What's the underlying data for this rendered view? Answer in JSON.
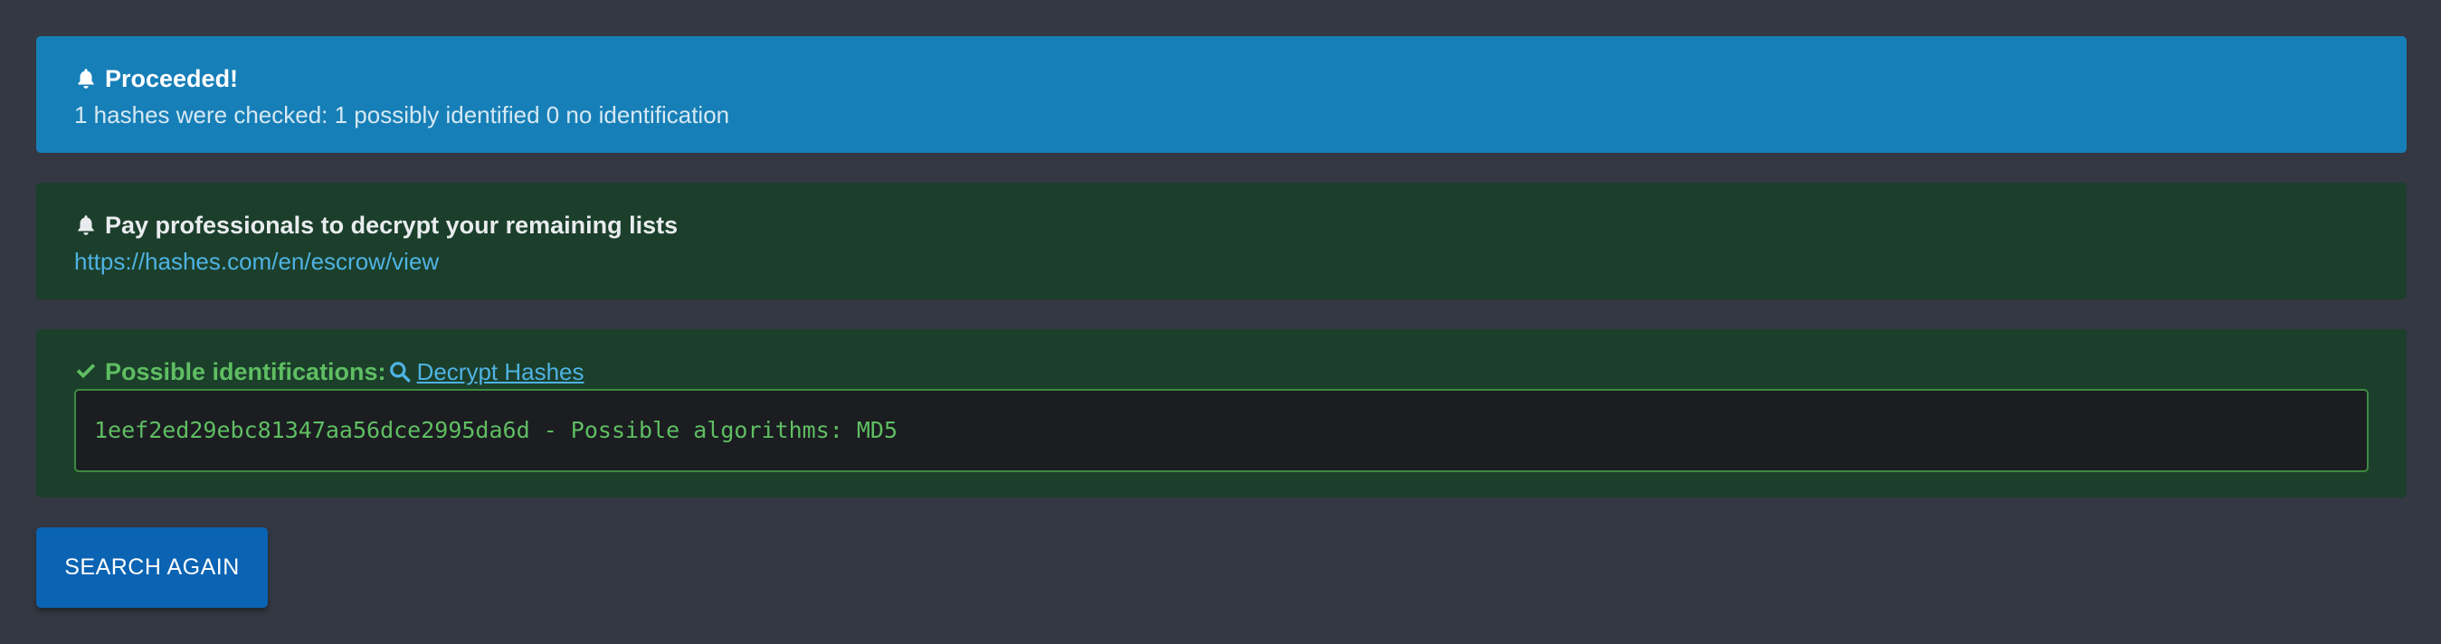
{
  "info_alert": {
    "title": "Proceeded!",
    "icon": "bell-icon",
    "message": "1 hashes were checked: 1 possibly identified 0 no identification"
  },
  "escrow_alert": {
    "title": "Pay professionals to decrypt your remaining lists",
    "icon": "bell-icon",
    "link_text": "https://hashes.com/en/escrow/view"
  },
  "result_alert": {
    "title": "Possible identifications:",
    "icon": "check-icon",
    "decrypt_link": "Decrypt Hashes",
    "decrypt_icon": "search-icon",
    "output": "1eef2ed29ebc81347aa56dce2995da6d - Possible algorithms: MD5"
  },
  "search_again_label": "SEARCH AGAIN",
  "colors": {
    "background": "#333842",
    "info": "#177fb7",
    "success_bg": "#1b3f2b",
    "success_text": "#5fbe62",
    "link": "#4fb3e3",
    "button": "#0a63b3"
  }
}
